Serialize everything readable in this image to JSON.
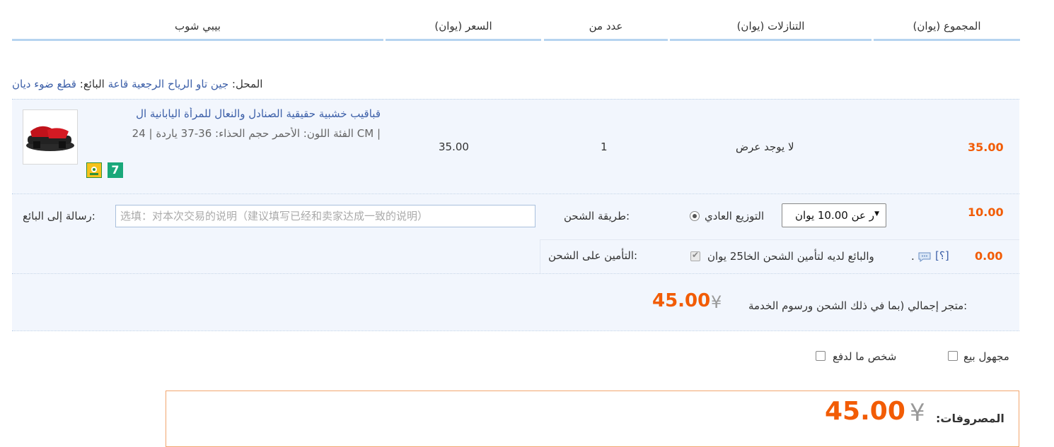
{
  "header": {
    "shop": "بيبي شوب",
    "price": "(السعر (يوان",
    "quantity": "عدد من",
    "discount": "(التنازلات (يوان",
    "total": "(المجموع (يوان"
  },
  "store": {
    "store_label": "المحل:",
    "store_name": "جين تاو الرياح الرجعية قاعة",
    "seller_label": "البائع:",
    "seller_name": "قطع ضوء ديان"
  },
  "item": {
    "title": "قباقيب خشبية حقيقية الصنادل والنعال للمرأة اليابانية ال",
    "attrs": "| CM الفئة اللون: الأحمر حجم الحذاء: 36-37 ياردة | 24",
    "badge_icon": "flower-badge-icon",
    "badge_seven": "7",
    "price": "35.00",
    "quantity": "1",
    "discount": "لا يوجد عرض",
    "total": "35.00"
  },
  "shipping": {
    "message_label": ":رسالة إلى البائع",
    "message_placeholder": "选填：对本次交易的说明（建议填写已经和卖家达成一致的说明）",
    "method_label": ":طريقة الشحن",
    "method_name": "التوزيع العادي",
    "select_value": "ر عن 10.00 يوان",
    "fee": "10.00",
    "insurance_label": ":التأمين على الشحن",
    "insurance_text": "والبائع لديه لتأمين الشحن الخا25 يوان",
    "insurance_help": "[؟]",
    "insurance_fee": "0.00"
  },
  "store_total": {
    "label": ":متجر إجمالي (بما في ذلك الشحن ورسوم الخدمة",
    "currency": "¥",
    "amount": "45.00"
  },
  "options": {
    "anonymous": "مجهول بيع",
    "someone_pay": "شخص ما لدفع"
  },
  "summary": {
    "label": "المصروفات:",
    "currency": "¥",
    "amount": "45.00"
  },
  "colors": {
    "accent": "#f25c05",
    "link": "#3c5fa8",
    "header_bar": "#b6d4f0",
    "row_bg": "#f2f6fd"
  }
}
